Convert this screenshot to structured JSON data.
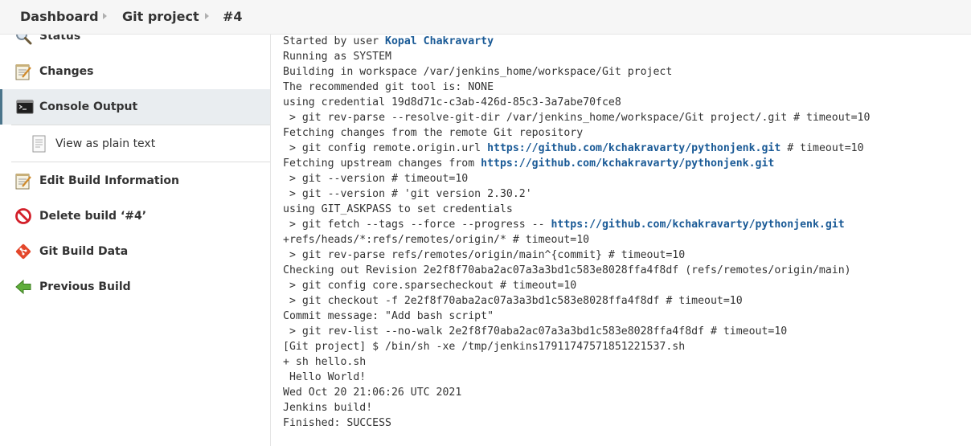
{
  "breadcrumb": {
    "items": [
      "Dashboard",
      "Git project",
      "#4"
    ]
  },
  "sidebar": {
    "items": [
      {
        "label": "Status",
        "icon": "magnifier-icon"
      },
      {
        "label": "Changes",
        "icon": "notepad-icon"
      },
      {
        "label": "Console Output",
        "icon": "terminal-icon",
        "active": true
      },
      {
        "label": "View as plain text",
        "icon": "document-icon"
      },
      {
        "label": "Edit Build Information",
        "icon": "notepad-icon"
      },
      {
        "label": "Delete build ‘#4’",
        "icon": "no-entry-icon"
      },
      {
        "label": "Git Build Data",
        "icon": "git-icon"
      },
      {
        "label": "Previous Build",
        "icon": "green-left-arrow-icon"
      }
    ]
  },
  "console": {
    "lines": [
      [
        {
          "t": "Started by user "
        },
        {
          "t": "Kopal Chakravarty",
          "link": true
        }
      ],
      [
        {
          "t": "Running as SYSTEM"
        }
      ],
      [
        {
          "t": "Building in workspace /var/jenkins_home/workspace/Git project"
        }
      ],
      [
        {
          "t": "The recommended git tool is: NONE"
        }
      ],
      [
        {
          "t": "using credential 19d8d71c-c3ab-426d-85c3-3a7abe70fce8"
        }
      ],
      [
        {
          "t": " > git rev-parse --resolve-git-dir /var/jenkins_home/workspace/Git project/.git # timeout=10"
        }
      ],
      [
        {
          "t": "Fetching changes from the remote Git repository"
        }
      ],
      [
        {
          "t": " > git config remote.origin.url "
        },
        {
          "t": "https://github.com/kchakravarty/pythonjenk.git",
          "link": true
        },
        {
          "t": " # timeout=10"
        }
      ],
      [
        {
          "t": "Fetching upstream changes from "
        },
        {
          "t": "https://github.com/kchakravarty/pythonjenk.git",
          "link": true
        }
      ],
      [
        {
          "t": " > git --version # timeout=10"
        }
      ],
      [
        {
          "t": " > git --version # 'git version 2.30.2'"
        }
      ],
      [
        {
          "t": "using GIT_ASKPASS to set credentials"
        }
      ],
      [
        {
          "t": " > git fetch --tags --force --progress -- "
        },
        {
          "t": "https://github.com/kchakravarty/pythonjenk.git",
          "link": true
        }
      ],
      [
        {
          "t": "+refs/heads/*:refs/remotes/origin/* # timeout=10"
        }
      ],
      [
        {
          "t": " > git rev-parse refs/remotes/origin/main^{commit} # timeout=10"
        }
      ],
      [
        {
          "t": "Checking out Revision 2e2f8f70aba2ac07a3a3bd1c583e8028ffa4f8df (refs/remotes/origin/main)"
        }
      ],
      [
        {
          "t": " > git config core.sparsecheckout # timeout=10"
        }
      ],
      [
        {
          "t": " > git checkout -f 2e2f8f70aba2ac07a3a3bd1c583e8028ffa4f8df # timeout=10"
        }
      ],
      [
        {
          "t": "Commit message: \"Add bash script\""
        }
      ],
      [
        {
          "t": " > git rev-list --no-walk 2e2f8f70aba2ac07a3a3bd1c583e8028ffa4f8df # timeout=10"
        }
      ],
      [
        {
          "t": "[Git project] $ /bin/sh -xe /tmp/jenkins17911747571851221537.sh"
        }
      ],
      [
        {
          "t": "+ sh hello.sh"
        }
      ],
      [
        {
          "t": " Hello World!"
        }
      ],
      [
        {
          "t": "Wed Oct 20 21:06:26 UTC 2021"
        }
      ],
      [
        {
          "t": "Jenkins build!"
        }
      ],
      [
        {
          "t": "Finished: SUCCESS"
        }
      ]
    ]
  },
  "colors": {
    "link": "#1a5a96",
    "active_bg": "#e9edf0",
    "active_border": "#4b758b",
    "breadcrumb_bg": "#f6f6f6"
  }
}
